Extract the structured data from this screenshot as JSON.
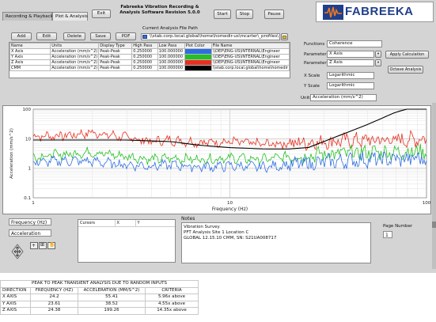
{
  "tabs": [
    {
      "label": "Recording & Playback"
    },
    {
      "label": "Plot & Analysis"
    }
  ],
  "header": {
    "exit_label": "Exit",
    "title_line1": "Fabreeka Vibration Recording &",
    "title_line2": "Analysis Software Revision 5.0.0",
    "start_label": "Start",
    "stop_label": "Stop",
    "pause_label": "Pause",
    "logo_text": "FABREEKA",
    "logo_color": "#1f3f8a"
  },
  "toolbar": {
    "add": "Add",
    "edit": "Edit",
    "delete": "Delete",
    "save": "Save",
    "pdf": "PDF"
  },
  "file_path": {
    "label": "Current Analysis File Path",
    "value": "\\\\stab.corp.local.global\\home\\homedir-us\\mcarter\\_profiles\\"
  },
  "channels": {
    "columns": [
      "Name",
      "Units",
      "Display Type",
      "High Pass",
      "Low Pass",
      "Plot Color",
      "File Name"
    ],
    "rows": [
      {
        "name": "X Axis",
        "units": "Acceleration (mm/s^2)",
        "display": "Peak-Peak",
        "hp": "0.250000",
        "lp": "100.000000",
        "color": "#2d6ee0",
        "file": "\\\\DEP\\ENG-US\\INTERNAL\\Engineer"
      },
      {
        "name": "Y Axis",
        "units": "Acceleration (mm/s^2)",
        "display": "Peak-Peak",
        "hp": "0.250000",
        "lp": "100.000000",
        "color": "#25c025",
        "file": "\\\\DEP\\ENG-US\\INTERNAL\\Engineer"
      },
      {
        "name": "Z Axis",
        "units": "Acceleration (mm/s^2)",
        "display": "Peak-Peak",
        "hp": "0.250000",
        "lp": "100.000000",
        "color": "#e83020",
        "file": "\\\\DEP\\ENG-US\\INTERNAL\\Engineer"
      },
      {
        "name": "CMM",
        "units": "Acceleration (mm/s^2)",
        "display": "Peak-Peak",
        "hp": "0.250000",
        "lp": "100.000000",
        "color": "#000000",
        "file": "\\\\stab.corp.local.global\\home\\homedir"
      }
    ]
  },
  "controls": {
    "functions_label": "Functions",
    "functions_value": "Coherence",
    "param1_label": "Parameter 1",
    "param1_value": "X Axis",
    "param2_label": "Parameter 2",
    "param2_value": "Z Axis",
    "xscale_label": "X Scale",
    "xscale_value": "Logarithmic",
    "yscale_label": "Y Scale",
    "yscale_value": "Logarithmic",
    "units_label": "Units",
    "units_value": "Acceleration (mm/s^2)",
    "apply_label": "Apply Calculation",
    "octave_label": "Octave Analysis"
  },
  "chart_data": {
    "type": "line",
    "title": "",
    "xlabel": "Frequency (Hz)",
    "ylabel": "Acceleration (mm/s^2)",
    "xlim": [
      1,
      100
    ],
    "ylim": [
      0.1,
      100
    ],
    "xscale": "log",
    "yscale": "log",
    "grid": true,
    "x_ticks": [
      "1",
      "10",
      "100"
    ],
    "y_ticks": [
      "0.1",
      "1",
      "10",
      "100"
    ],
    "series": [
      {
        "name": "Z Axis",
        "color": "#e83020",
        "x": [
          1,
          1.5,
          2,
          3,
          4,
          5,
          7,
          10,
          15,
          20,
          30,
          50,
          70,
          100
        ],
        "y": [
          12,
          13,
          16,
          11,
          8,
          9,
          7.5,
          8,
          6.5,
          7,
          8,
          9,
          9,
          10
        ]
      },
      {
        "name": "CMM",
        "color": "#000000",
        "x": [
          1,
          2,
          3,
          5,
          7,
          10,
          15,
          20,
          25,
          30,
          50,
          70,
          100
        ],
        "y": [
          9,
          9,
          9,
          8,
          6,
          5,
          4.5,
          4.5,
          5,
          8,
          30,
          80,
          150
        ]
      },
      {
        "name": "Y Axis",
        "color": "#25c025",
        "x": [
          1,
          1.5,
          2,
          3,
          4,
          5,
          7,
          10,
          15,
          20,
          30,
          50,
          70,
          100
        ],
        "y": [
          2.5,
          3,
          3.5,
          2.5,
          2,
          2.2,
          2,
          2.2,
          2,
          2.5,
          3,
          3.5,
          3.5,
          3.8
        ]
      },
      {
        "name": "X Axis",
        "color": "#2d6ee0",
        "x": [
          1,
          1.5,
          2,
          3,
          4,
          5,
          7,
          10,
          15,
          20,
          30,
          50,
          70,
          100
        ],
        "y": [
          1.6,
          1.8,
          1.7,
          1.3,
          1.2,
          1.3,
          1.1,
          1.2,
          1.1,
          1.3,
          1.6,
          2,
          2,
          2.2
        ]
      }
    ]
  },
  "bottom": {
    "xfield": "Frequency (Hz)",
    "yfield": "Acceleration",
    "cursor_headers": [
      "Cursors",
      "X",
      "Y"
    ],
    "notes_label": "Notes",
    "notes_lines": [
      "Vibration Survey",
      "PFT Analysis Site 1 Location C",
      "GLOBAL 12.15.10 CMM, SN: S21UA008717"
    ],
    "page_label": "Page Number",
    "page_value": "1"
  },
  "summary": {
    "title": "PEAK TO PEAK TRANSIENT ANALYSIS DUE TO RANDOM INPUTS",
    "headers": [
      "DIRECTION",
      "FREQUENCY (HZ)",
      "ACCELERATION (MM/S^2)",
      "CRITERIA"
    ],
    "rows": [
      [
        "X AXIS",
        "24.2",
        "55.41",
        "5.96x above"
      ],
      [
        "Y AXIS",
        "23.61",
        "38.52",
        "4.55x above"
      ],
      [
        "Z AXIS",
        "24.38",
        "199.26",
        "14.35x above"
      ]
    ]
  }
}
